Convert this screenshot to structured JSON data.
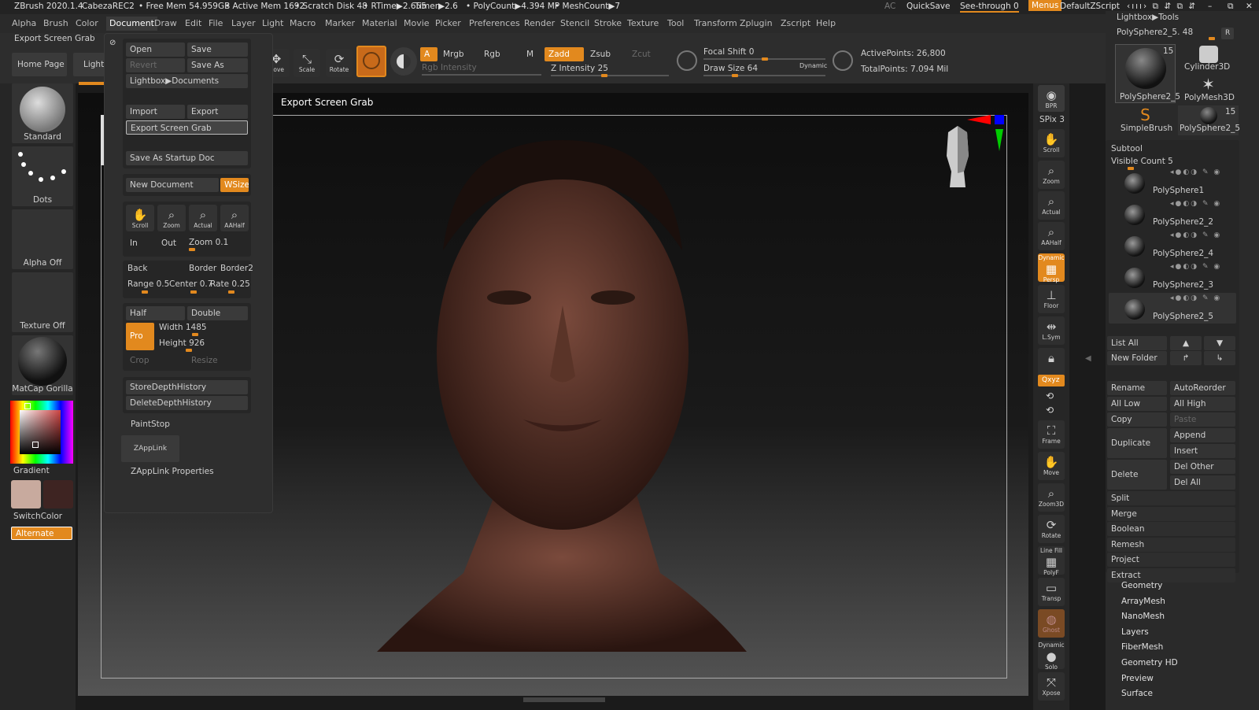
{
  "titlebar": {
    "app": "ZBrush 2020.1.4",
    "doc": "CabezaREC2",
    "free_mem": "• Free Mem 54.959GB",
    "active_mem": "• Active Mem 1692",
    "scratch": "• Scratch Disk 48",
    "rtime": "• RTime▶2.655",
    "timer": "Timer▶2.6",
    "polycount": "• PolyCount▶4.394 MP",
    "meshcount": "• MeshCount▶7",
    "ac": "AC",
    "quicksave": "QuickSave",
    "seethrough": "See-through",
    "seethrough_val": "0",
    "menus": "Menus",
    "zscript": "DefaultZScript"
  },
  "menubar": [
    "Alpha",
    "Brush",
    "Color",
    "Document",
    "Draw",
    "Edit",
    "File",
    "Layer",
    "Light",
    "Macro",
    "Marker",
    "Material",
    "Movie",
    "Picker",
    "Preferences",
    "Render",
    "Stencil",
    "Stroke",
    "Texture",
    "Tool",
    "Transform",
    "Zplugin",
    "Zscript",
    "Help"
  ],
  "popup_title": "Export Screen Grab",
  "shelf": {
    "home": "Home Page",
    "lightbox": "LightBox",
    "move": "Move",
    "scale": "Scale",
    "rotate": "Rotate",
    "a": "A",
    "mrgb": "Mrgb",
    "rgb": "Rgb",
    "m": "M",
    "zadd": "Zadd",
    "zsub": "Zsub",
    "zcut": "Zcut",
    "rgb_intensity": "Rgb Intensity",
    "z_intensity": "Z Intensity",
    "z_intensity_val": "25",
    "focal_shift": "Focal Shift",
    "focal_shift_val": "0",
    "draw_size": "Draw Size",
    "draw_size_val": "64",
    "dynamic": "Dynamic",
    "active_points": "ActivePoints: 26,800",
    "total_points": "TotalPoints: 7.094 Mil"
  },
  "leftshelf": {
    "standard": "Standard",
    "dots": "Dots",
    "alpha_off": "Alpha Off",
    "texture_off": "Texture Off",
    "matcap": "MatCap Gorilla",
    "gradient": "Gradient",
    "switchcolor": "SwitchColor",
    "alternate": "Alternate",
    "color_main": "#c8aa9e",
    "color_secondary": "#3e2422"
  },
  "doc": {
    "open": "Open",
    "save": "Save",
    "revert": "Revert",
    "saveas": "Save As",
    "lightbox_docs": "Lightbox▶Documents",
    "import": "Import",
    "export": "Export",
    "export_grab": "Export Screen Grab",
    "save_startup": "Save As Startup Doc",
    "new_document": "New Document",
    "wsize": "WSize",
    "scroll": "Scroll",
    "zoom": "Zoom",
    "actual": "Actual",
    "aahalf": "AAHalf",
    "in": "In",
    "out": "Out",
    "zoom_label": "Zoom",
    "zoom_val": "0.1",
    "back": "Back",
    "border": "Border",
    "border2": "Border2",
    "range": "Range",
    "range_val": "0.5",
    "center": "Center",
    "center_val": "0.7",
    "rate": "Rate",
    "rate_val": "0.25",
    "half": "Half",
    "double": "Double",
    "pro": "Pro",
    "width": "Width",
    "width_val": "1485",
    "height": "Height",
    "height_val": "926",
    "crop": "Crop",
    "resize": "Resize",
    "store_depth": "StoreDepthHistory",
    "delete_depth": "DeleteDepthHistory",
    "paintstop": "PaintStop",
    "zapplink": "ZAppLink",
    "zapplink_props": "ZAppLink Properties"
  },
  "viewport_label": "Export Screen Grab",
  "rightbar": {
    "bpr": "BPR",
    "spix": "SPix 3",
    "scroll": "Scroll",
    "zoom": "Zoom",
    "actual": "Actual",
    "aahalf": "AAHalf",
    "dynamic": "Dynamic",
    "persp": "Persp",
    "floor": "Floor",
    "lsym": "L.Sym",
    "xyz": "Qxyz",
    "frame": "Frame",
    "move": "Move",
    "zoom3d": "Zoom3D",
    "rotate": "Rotate",
    "linefill": "Line Fill",
    "polyf": "PolyF",
    "transp": "Transp",
    "ghost": "Ghost",
    "dynamic2": "Dynamic",
    "solo": "Solo",
    "xpose": "Xpose"
  },
  "rightpanel": {
    "lightbox_tools": "Lightbox▶Tools",
    "current_tool": "PolySphere2_5. 48",
    "r": "R",
    "tools": [
      {
        "name": "PolySphere2_5",
        "count": "15"
      },
      {
        "name": "Cylinder3D",
        "count": ""
      },
      {
        "name": "PolyMesh3D",
        "count": ""
      },
      {
        "name": "SimpleBrush",
        "count": ""
      },
      {
        "name": "PolySphere2_5",
        "count": "15"
      }
    ],
    "subtool": "Subtool",
    "visible_count": "Visible Count 5",
    "subtools": [
      "PolySphere1",
      "PolySphere2_2",
      "PolySphere2_4",
      "PolySphere2_3",
      "PolySphere2_5"
    ],
    "list_all": "List All",
    "new_folder": "New Folder",
    "rename": "Rename",
    "autoreorder": "AutoReorder",
    "all_low": "All Low",
    "all_high": "All High",
    "copy": "Copy",
    "paste": "Paste",
    "duplicate": "Duplicate",
    "append": "Append",
    "insert": "Insert",
    "delete": "Delete",
    "del_other": "Del Other",
    "del_all": "Del All",
    "actions": [
      "Split",
      "Merge",
      "Boolean",
      "Remesh",
      "Project",
      "Extract"
    ],
    "sections": [
      "Geometry",
      "ArrayMesh",
      "NanoMesh",
      "Layers",
      "FiberMesh",
      "Geometry HD",
      "Preview",
      "Surface"
    ]
  }
}
